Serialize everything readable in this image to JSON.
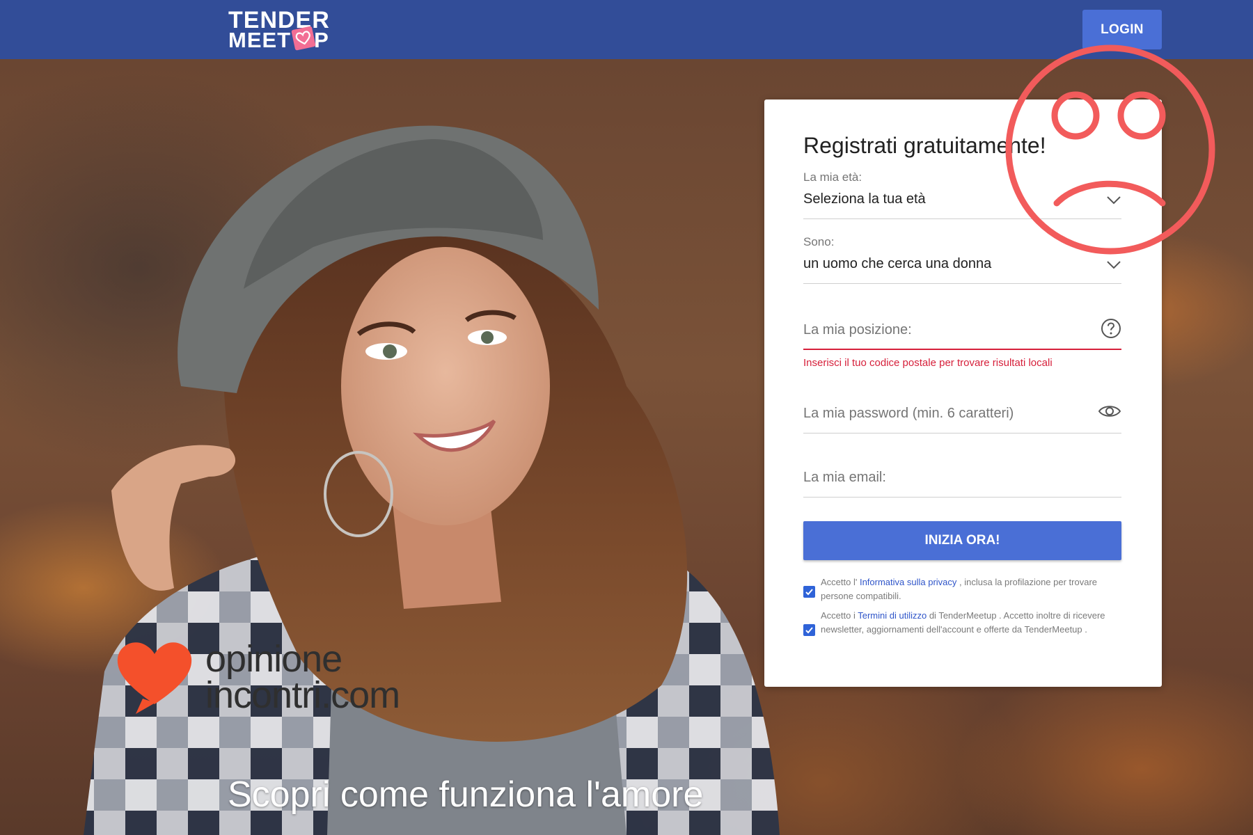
{
  "header": {
    "logo_line1": "TENDER",
    "logo_line2": "MEET UP",
    "login_label": "LOGIN"
  },
  "form": {
    "title": "Registrati gratuitamente!",
    "age": {
      "label": "La mia età:",
      "value": "Seleziona la tua età"
    },
    "gender": {
      "label": "Sono:",
      "value": "un uomo che cerca una donna"
    },
    "position": {
      "placeholder": "La mia posizione:",
      "error": "Inserisci il tuo codice postale per trovare risultati locali"
    },
    "password": {
      "placeholder": "La mia password (min. 6 caratteri)"
    },
    "email": {
      "placeholder": "La mia email:"
    },
    "submit_label": "INIZIA ORA!",
    "consent_privacy": {
      "before": "Accetto l' ",
      "link": "Informativa sulla privacy",
      "after": " , inclusa la profilazione per trovare persone compatibili.",
      "checked": true
    },
    "consent_terms": {
      "before": "Accetto i ",
      "link": "Termini di utilizzo",
      "after": " di TenderMeetup . Accetto inoltre di ricevere newsletter, aggiornamenti dell'account e offerte da TenderMeetup .",
      "checked": true
    }
  },
  "watermark": {
    "line1": "opinione",
    "line2": "incontri.com"
  },
  "hero": {
    "tagline": "Scopri come funziona l'amore"
  },
  "colors": {
    "header_bg": "#324d98",
    "button_blue": "#4a6fd6",
    "error_red": "#d61f3a",
    "watermark_heart": "#f4502b",
    "sadface_red": "#f25b5b"
  }
}
